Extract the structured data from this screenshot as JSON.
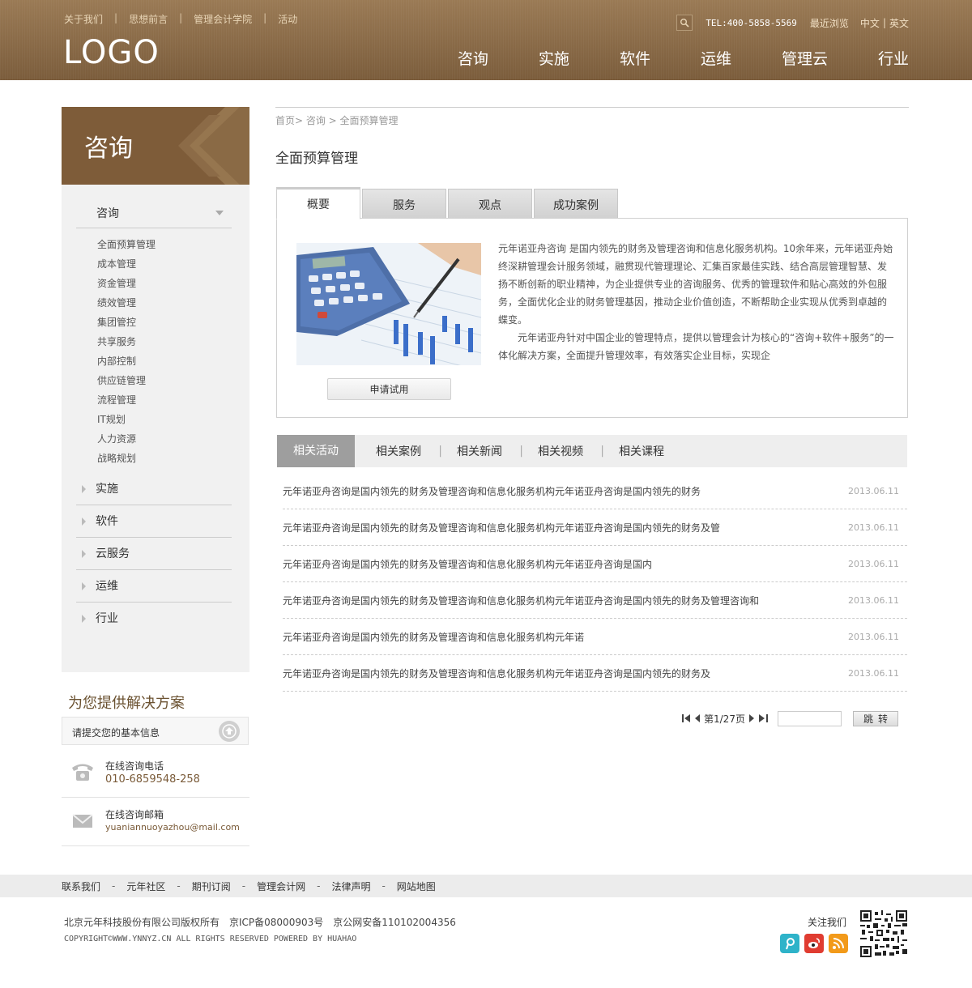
{
  "header": {
    "top_links": [
      "关于我们",
      "思想前言",
      "管理会计学院",
      "活动"
    ],
    "logo": "LOGO",
    "tel": "TEL:400-5858-5569",
    "recent": "最近浏览",
    "lang_cn": "中文",
    "lang_en": "英文",
    "nav": [
      "咨询",
      "实施",
      "软件",
      "运维",
      "管理云",
      "行业"
    ]
  },
  "sidebar": {
    "title": "咨询",
    "current_section": "咨询",
    "sub_items": [
      "全面预算管理",
      "成本管理",
      "资金管理",
      "绩效管理",
      "集团管控",
      "共享服务",
      "内部控制",
      "供应链管理",
      "流程管理",
      "IT规划",
      "人力资源",
      "战略规划"
    ],
    "other_sections": [
      "实施",
      "软件",
      "云服务",
      "运维",
      "行业"
    ]
  },
  "solutions": {
    "title": "为您提供解决方案",
    "submit_text": "请提交您的基本信息",
    "phone_label": "在线咨询电话",
    "phone": "010-6859548-258",
    "email_label": "在线咨询邮箱",
    "email": "yuaniannuoyazhou@mail.com"
  },
  "main": {
    "breadcrumb": "首页> 咨询 > 全面预算管理",
    "title": "全面预算管理",
    "tabs": [
      "概要",
      "服务",
      "观点",
      "成功案例"
    ],
    "active_tab": "概要",
    "try_button": "申请试用",
    "paragraph1": "元年诺亚舟咨询 是国内领先的财务及管理咨询和信息化服务机构。10余年来，元年诺亚舟始终深耕管理会计服务领域，融贯现代管理理论、汇集百家最佳实践、结合高层管理智慧、发扬不断创新的职业精神，为企业提供专业的咨询服务、优秀的管理软件和贴心高效的外包服务，全面优化企业的财务管理基因，推动企业价值创造，不断帮助企业实现从优秀到卓越的蝶变。",
    "paragraph2": "元年诺亚舟针对中国企业的管理特点，提供以管理会计为核心的“咨询+软件+服务”的一体化解决方案，全面提升管理效率，有效落实企业目标，实现企"
  },
  "related": {
    "tabs": [
      "相关活动",
      "相关案例",
      "相关新闻",
      "相关视频",
      "相关课程"
    ],
    "active_tab": "相关活动",
    "items": [
      {
        "title": "元年诺亚舟咨询是国内领先的财务及管理咨询和信息化服务机构元年诺亚舟咨询是国内领先的财务",
        "date": "2013.06.11"
      },
      {
        "title": "元年诺亚舟咨询是国内领先的财务及管理咨询和信息化服务机构元年诺亚舟咨询是国内领先的财务及管",
        "date": "2013.06.11"
      },
      {
        "title": "元年诺亚舟咨询是国内领先的财务及管理咨询和信息化服务机构元年诺亚舟咨询是国内",
        "date": "2013.06.11"
      },
      {
        "title": "元年诺亚舟咨询是国内领先的财务及管理咨询和信息化服务机构元年诺亚舟咨询是国内领先的财务及管理咨询和",
        "date": "2013.06.11"
      },
      {
        "title": "元年诺亚舟咨询是国内领先的财务及管理咨询和信息化服务机构元年诺",
        "date": "2013.06.11"
      },
      {
        "title": "元年诺亚舟咨询是国内领先的财务及管理咨询和信息化服务机构元年诺亚舟咨询是国内领先的财务及",
        "date": "2013.06.11"
      }
    ]
  },
  "pager": {
    "page_info": "第1/27页",
    "jump_label": "跳转"
  },
  "footer": {
    "links": [
      "联系我们",
      "元年社区",
      "期刊订阅",
      "管理会计网",
      "法律声明",
      "网站地图"
    ],
    "copyright": "北京元年科技股份有限公司版权所有　京ICP备08000903号　京公网安备110102004356",
    "powered": "COPYRIGHT©WWW.YNNYZ.CN ALL RIGHTS RESERVED POWERED BY HUAHAO",
    "follow": "关注我们"
  },
  "icons": {
    "search": "search-icon",
    "phone": "phone-icon",
    "email": "mail-icon",
    "up": "arrow-up-icon",
    "social": [
      "tencent-weibo-icon",
      "sina-weibo-icon",
      "rss-icon"
    ]
  },
  "colors": {
    "header_brown": "#8a6b49",
    "sidebar_head": "#7e5c39",
    "active_tab_gray": "#9e9e9e",
    "accent_text": "#7a5b39"
  }
}
